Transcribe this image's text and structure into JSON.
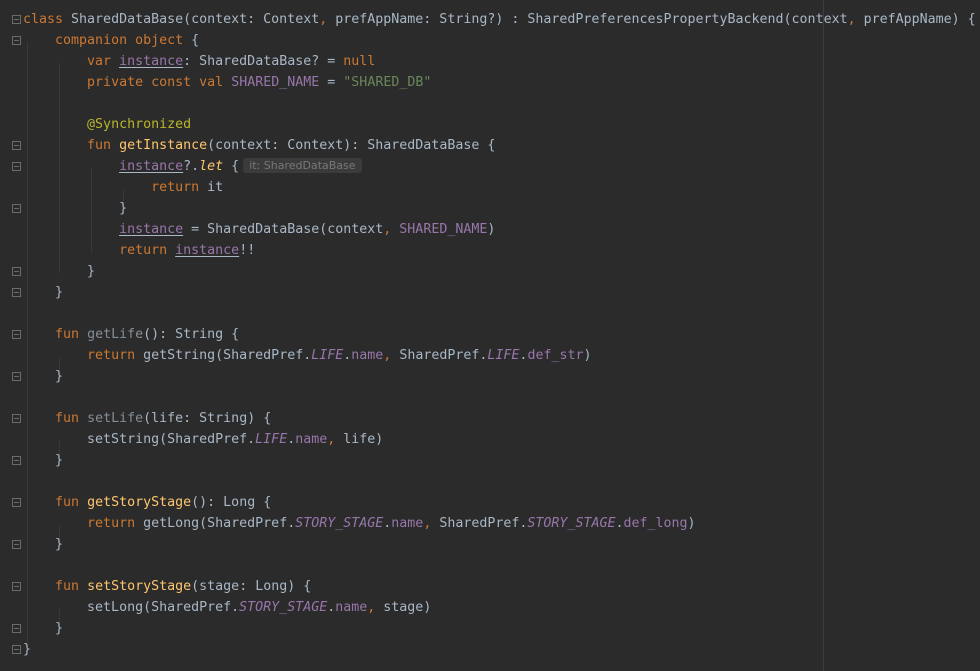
{
  "editor": {
    "language": "kotlin",
    "lines": [
      "class SharedDataBase(context: Context, prefAppName: String?) : SharedPreferencesPropertyBackend(context, prefAppName) {",
      "    companion object {",
      "        var instance: SharedDataBase? = null",
      "        private const val SHARED_NAME = \"SHARED_DB\"",
      "",
      "        @Synchronized",
      "        fun getInstance(context: Context): SharedDataBase {",
      "            instance?.let {",
      "                return it",
      "            }",
      "            instance = SharedDataBase(context, SHARED_NAME)",
      "            return instance!!",
      "        }",
      "    }",
      "",
      "    fun getLife(): String {",
      "        return getString(SharedPref.LIFE.name, SharedPref.LIFE.def_str)",
      "    }",
      "",
      "    fun setLife(life: String) {",
      "        setString(SharedPref.LIFE.name, life)",
      "    }",
      "",
      "    fun getStoryStage(): Long {",
      "        return getLong(SharedPref.STORY_STAGE.name, SharedPref.STORY_STAGE.def_long)",
      "    }",
      "",
      "    fun setStoryStage(stage: Long) {",
      "        setLong(SharedPref.STORY_STAGE.name, stage)",
      "    }",
      "}"
    ],
    "inlay_hint": "it: SharedDataBase"
  },
  "colors": {
    "background": "#2b2b2b",
    "keyword": "#cc7832",
    "function": "#ffc66d",
    "string": "#6a8759",
    "property": "#9876aa",
    "annotation": "#bbb529",
    "text": "#a9b7c6"
  }
}
